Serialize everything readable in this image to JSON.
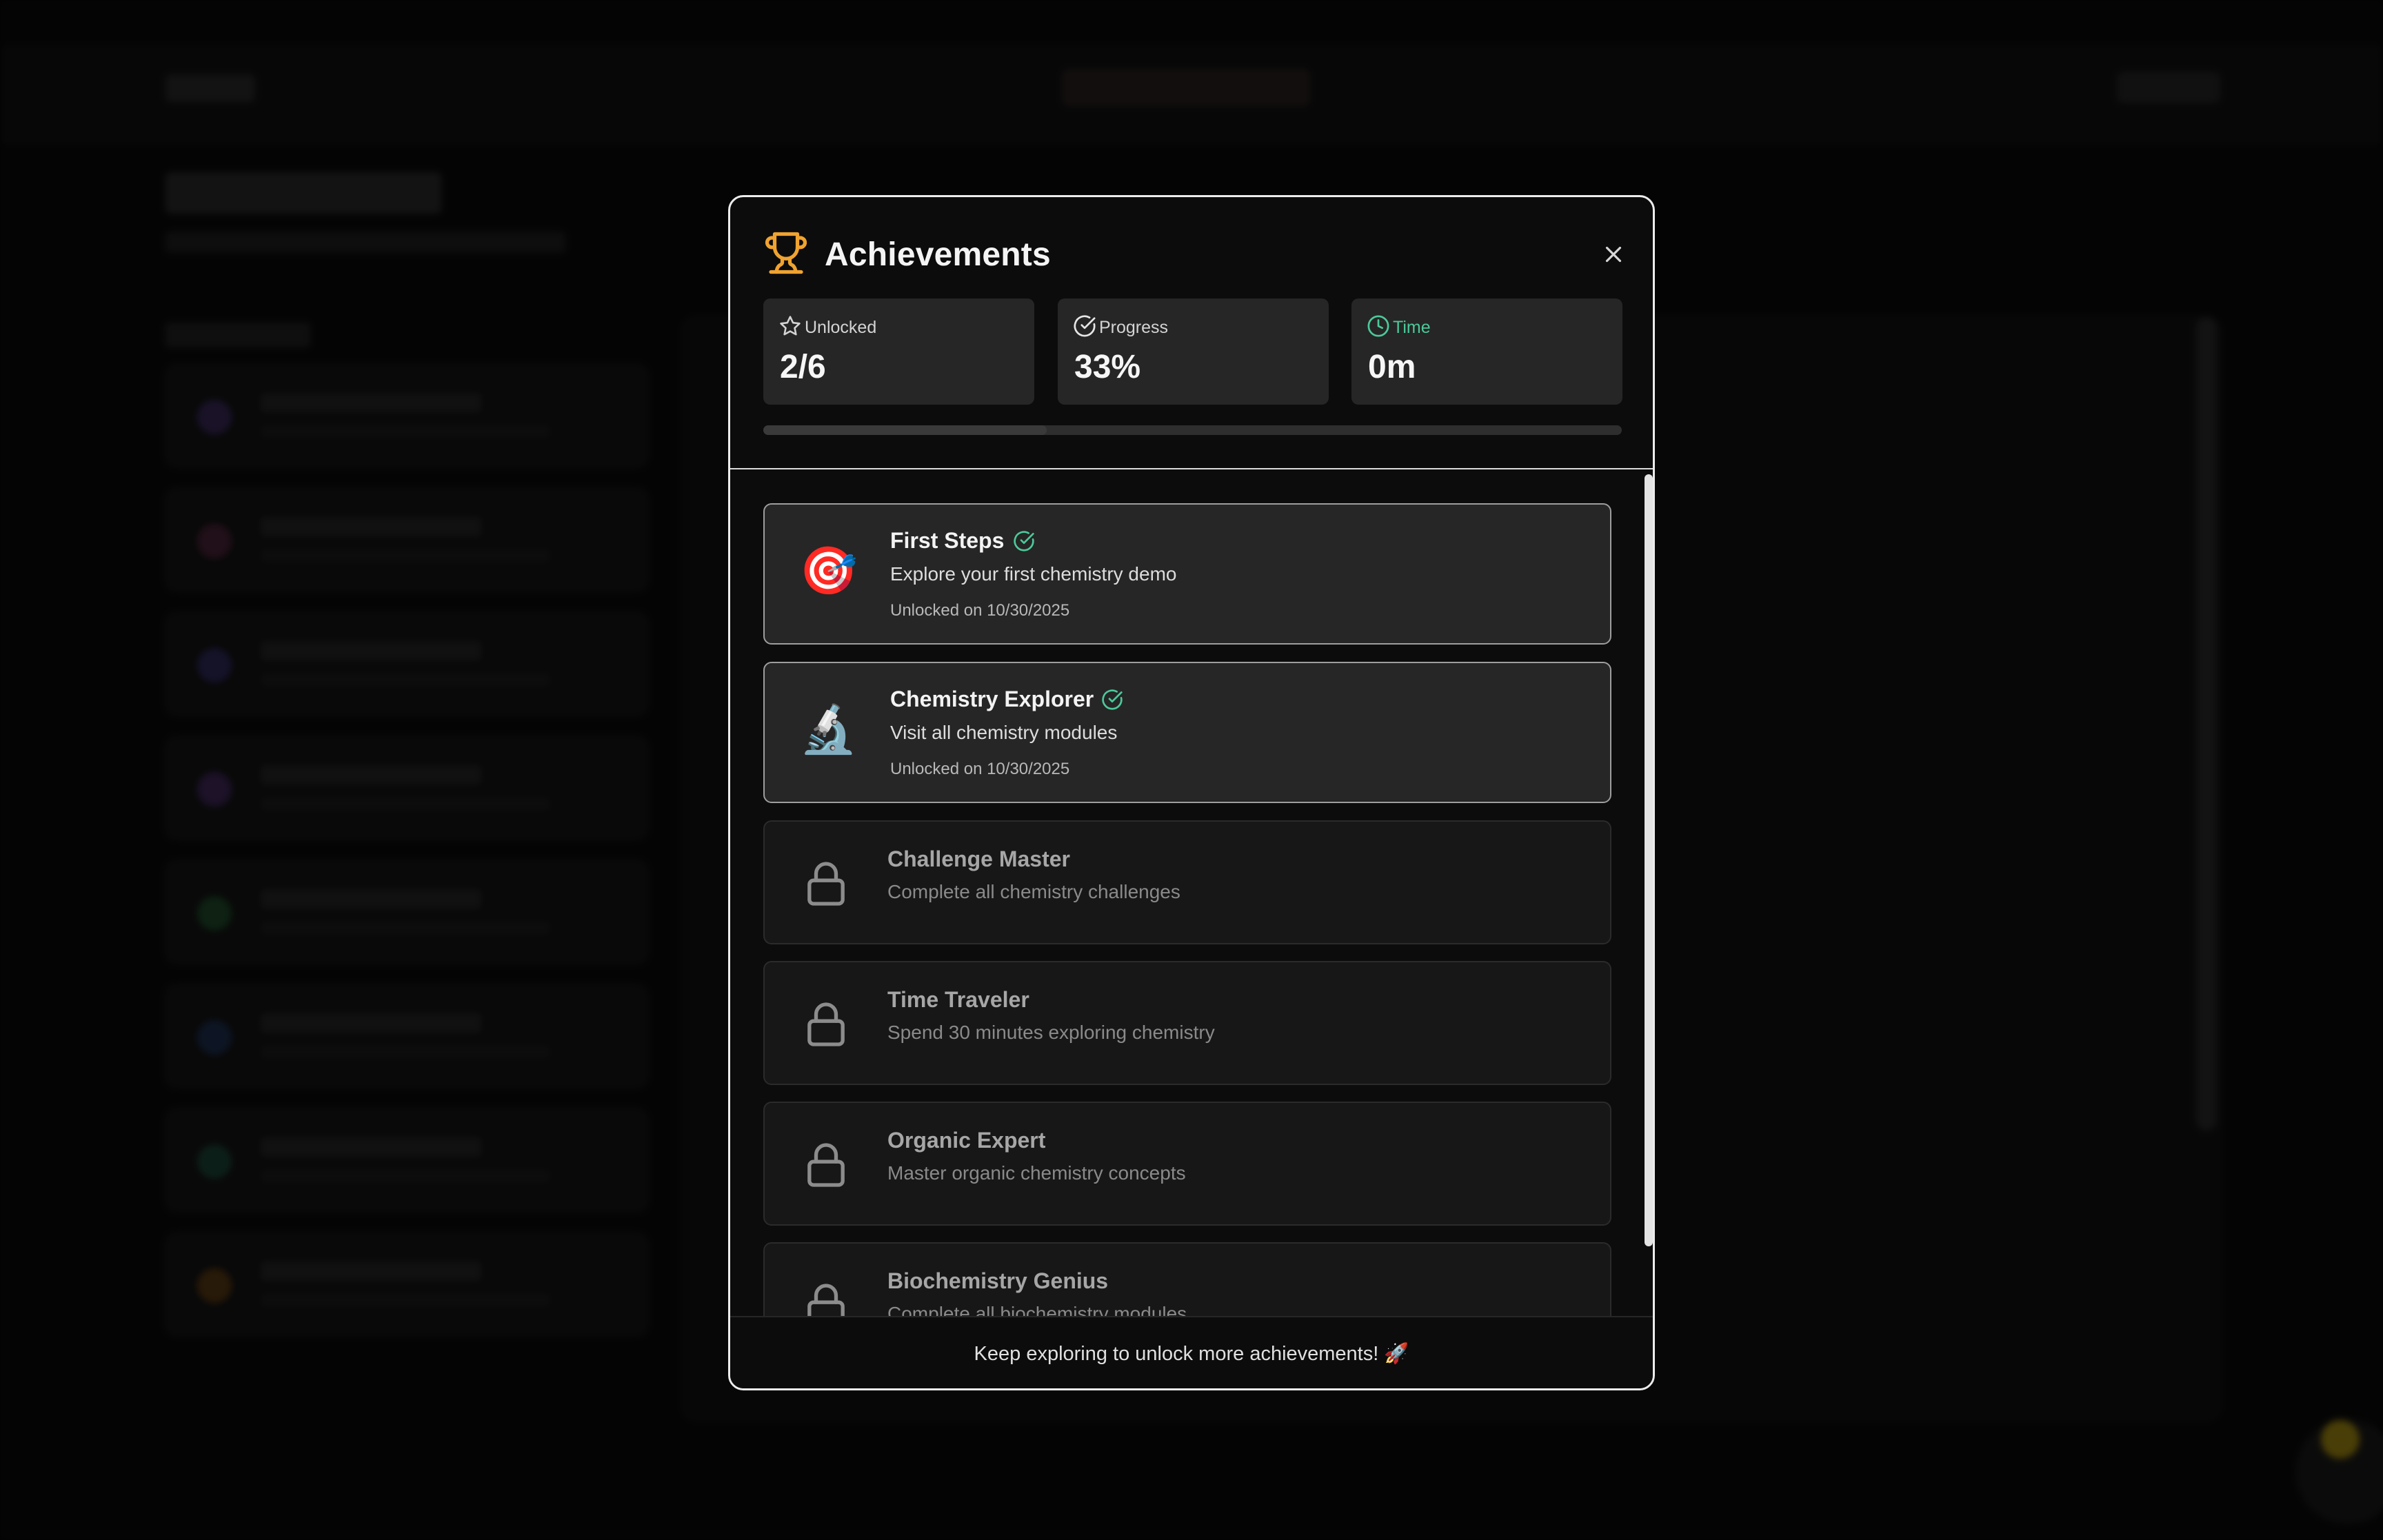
{
  "modal": {
    "title": "Achievements",
    "trophy_icon": "trophy-icon",
    "close_icon": "close-icon",
    "accent_color": "#f0a330"
  },
  "stats": {
    "unlocked": {
      "label": "Unlocked",
      "value": "2/6",
      "icon": "star-icon"
    },
    "progress": {
      "label": "Progress",
      "value": "33%",
      "icon": "check-circle-icon"
    },
    "time": {
      "label": "Time",
      "value": "0m",
      "icon": "clock-icon",
      "color": "#4cc99a"
    }
  },
  "progress_bar": {
    "percent": 33
  },
  "achievements": [
    {
      "title": "First Steps",
      "description": "Explore your first chemistry demo",
      "unlocked_text": "Unlocked on 10/30/2025",
      "icon": "dart-target-emoji",
      "emoji": "🎯",
      "status": "unlocked"
    },
    {
      "title": "Chemistry Explorer",
      "description": "Visit all chemistry modules",
      "unlocked_text": "Unlocked on 10/30/2025",
      "icon": "microscope-emoji",
      "emoji": "🔬",
      "status": "unlocked"
    },
    {
      "title": "Challenge Master",
      "description": "Complete all chemistry challenges",
      "icon": "lock-icon",
      "status": "locked"
    },
    {
      "title": "Time Traveler",
      "description": "Spend 30 minutes exploring chemistry",
      "icon": "lock-icon",
      "status": "locked"
    },
    {
      "title": "Organic Expert",
      "description": "Master organic chemistry concepts",
      "icon": "lock-icon",
      "status": "locked"
    },
    {
      "title": "Biochemistry Genius",
      "description": "Complete all biochemistry modules",
      "icon": "lock-icon",
      "status": "locked"
    }
  ],
  "footer": {
    "text": "Keep exploring to unlock more achievements! 🚀"
  },
  "colors": {
    "success": "#4cc99a",
    "modal_border": "#ececec",
    "card_bg": "#262626"
  }
}
